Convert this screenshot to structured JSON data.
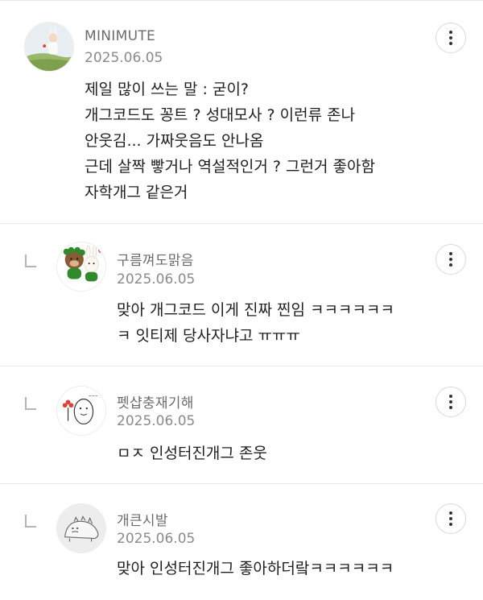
{
  "comments": [
    {
      "author": "MINIMUTE",
      "date": "2025.06.05",
      "text": "제일 많이 쓰는 말 : 굳이?\n개그코드도 꽁트 ? 성대모사 ? 이런류 존나\n안웃김... 가짜웃음도 안나옴\n근데 살짝 빻거나 역설적인거 ? 그런거 좋아함\n자학개그 같은거",
      "avatar_icon": "person-outdoor-avatar"
    },
    {
      "author": "구름껴도맑음",
      "date": "2025.06.05",
      "text": "맞아 개그코드 이게 진짜 찐임 ㅋㅋㅋㅋㅋㅋ\nㅋ 잇티제 당사자냐고 ㅠㅠㅠ",
      "avatar_icon": "bear-bunny-character-avatar"
    },
    {
      "author": "펫샵충재기해",
      "date": "2025.06.05",
      "text": "ㅁㅈ 인성터진개그 존웃",
      "avatar_icon": "doodle-character-avatar"
    },
    {
      "author": "개큰시발",
      "date": "2025.06.05",
      "text": "맞아 인성터진개그 좋아하더랔ㅋㅋㅋㅋㅋㅋ",
      "avatar_icon": "dinosaur-doodle-avatar"
    }
  ]
}
